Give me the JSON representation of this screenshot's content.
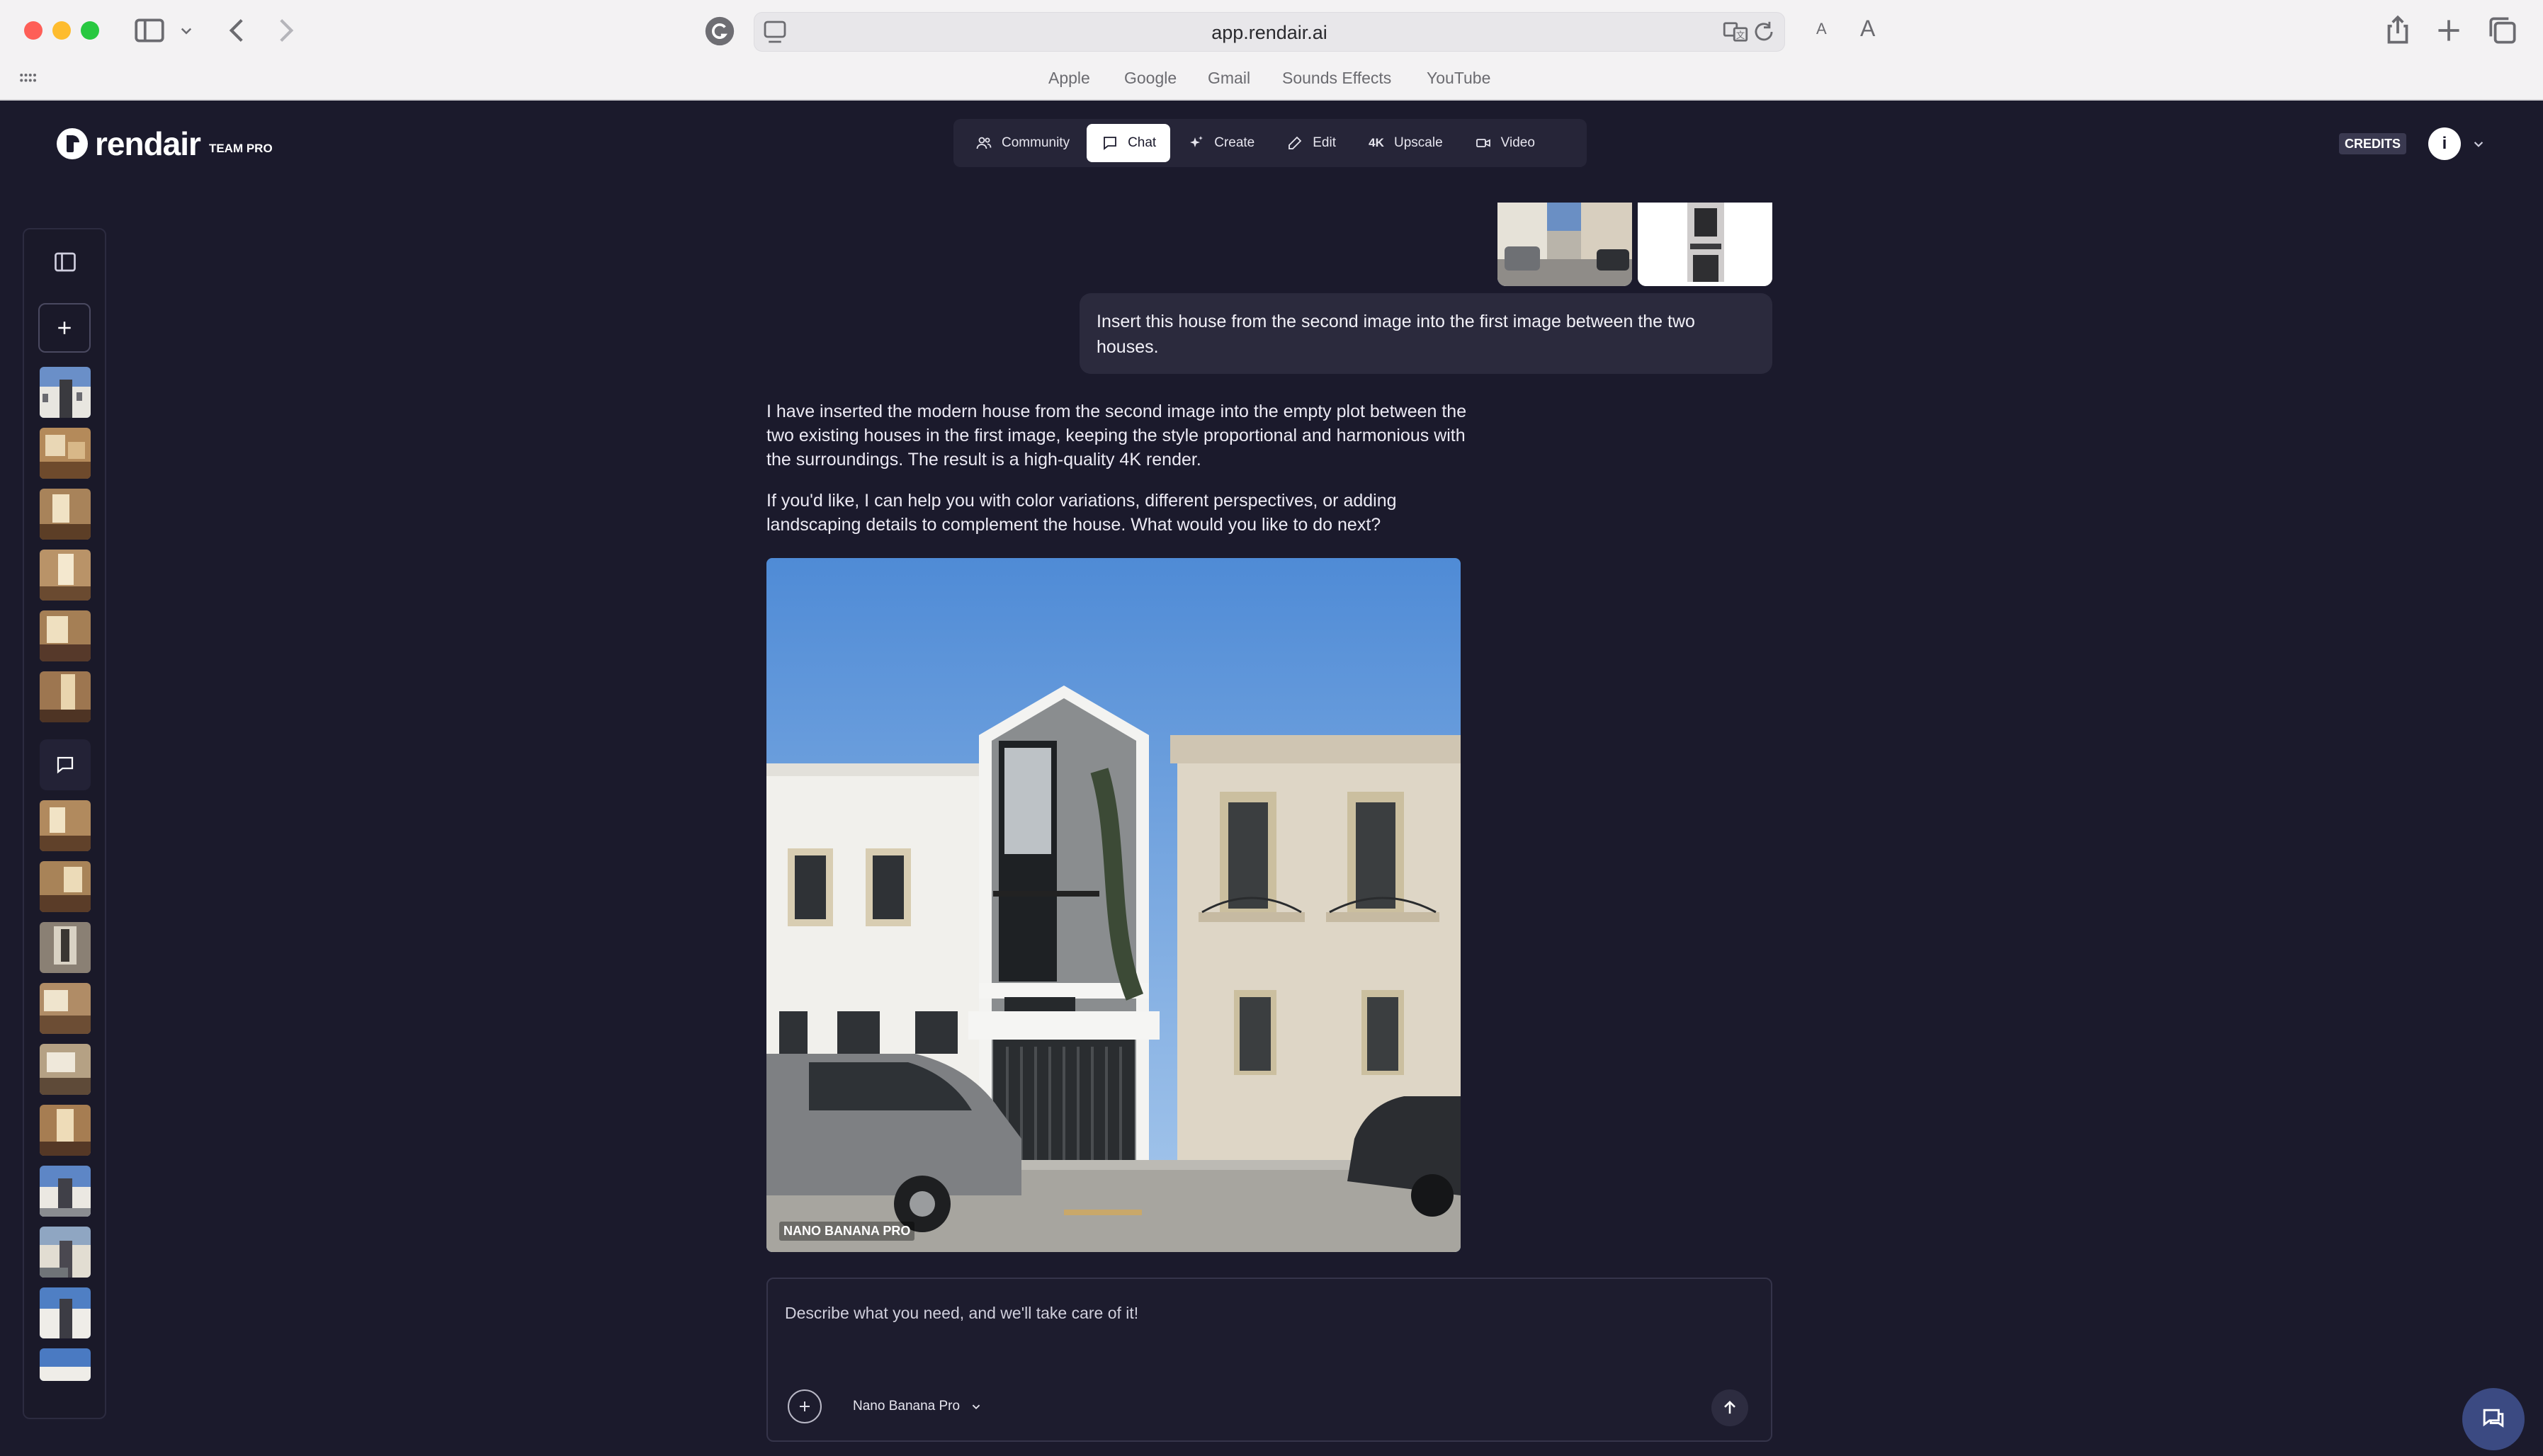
{
  "browser": {
    "url": "app.rendair.ai",
    "favorites": [
      "Apple",
      "Google",
      "Gmail",
      "Sounds Effects",
      "YouTube"
    ],
    "text_size_small": "A",
    "text_size_large": "A"
  },
  "app": {
    "brand": "rendair",
    "tier": "TEAM PRO",
    "nav": [
      {
        "label": "Community",
        "icon": "users-icon"
      },
      {
        "label": "Chat",
        "icon": "chat-icon",
        "active": true
      },
      {
        "label": "Create",
        "icon": "sparkle-icon"
      },
      {
        "label": "Edit",
        "icon": "pencil-icon"
      },
      {
        "label": "Upscale",
        "icon_text": "4K"
      },
      {
        "label": "Video",
        "icon": "video-icon"
      }
    ],
    "credits_label": "CREDITS",
    "avatar_initial": "i"
  },
  "chat": {
    "user_message": "Insert this house from the second image into the first image between the two houses.",
    "assistant_paragraphs": [
      "I have inserted the modern house from the second image into the empty plot between the two existing houses in the first image, keeping the style proportional and harmonious with the surroundings. The result is a high-quality 4K render.",
      "If you'd like, I can help you with color variations, different perspectives, or adding landscaping details to complement the house. What would you like to do next?"
    ],
    "result_model_label": "NANO BANANA PRO"
  },
  "composer": {
    "placeholder": "Describe what you need, and we'll take care of it!",
    "model": "Nano Banana Pro"
  },
  "colors": {
    "app_background": "#1b1a2c",
    "bubble": "#2b2a3d",
    "accent_fab": "#3b4a82"
  }
}
